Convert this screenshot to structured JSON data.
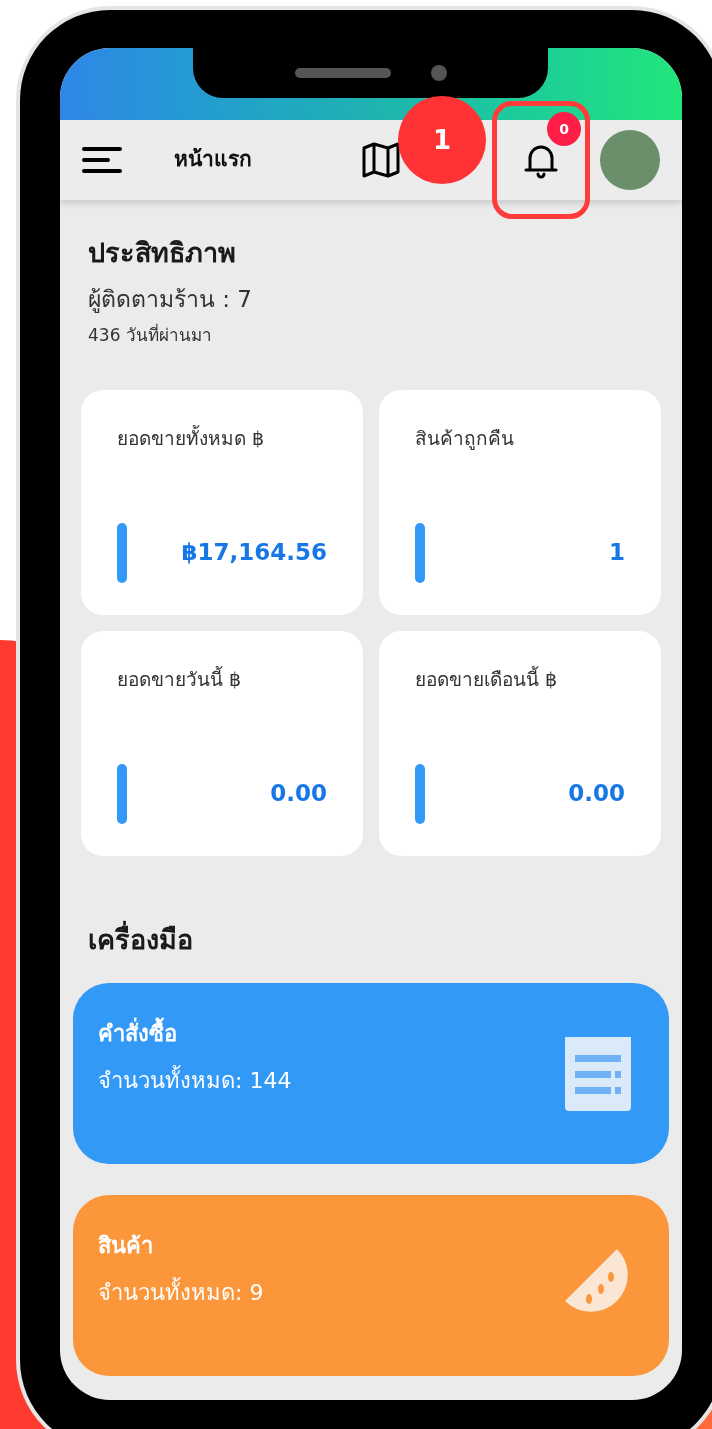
{
  "header": {
    "title": "หน้าแรก",
    "annotation": "1",
    "notification_count": "0"
  },
  "performance": {
    "title": "ประสิทธิภาพ",
    "followers": "ผู้ติดตามร้าน : 7",
    "days": "436 วันที่ผ่านมา"
  },
  "stats": [
    {
      "label": "ยอดขายทั้งหมด ฿",
      "value": "฿17,164.56"
    },
    {
      "label": "สินค้าถูกคืน",
      "value": "1"
    },
    {
      "label": "ยอดขายวันนี้ ฿",
      "value": "0.00"
    },
    {
      "label": "ยอดขายเดือนนี้ ฿",
      "value": "0.00"
    }
  ],
  "tools": {
    "title": "เครื่องมือ",
    "items": [
      {
        "kind": "receipt",
        "color": "#3399f7",
        "title": "คำสั่งซื้อ",
        "count": "จำนวนทั้งหมด: 144"
      },
      {
        "kind": "fruit",
        "color": "#fb963a",
        "title": "สินค้า",
        "count": "จำนวนทั้งหมด: 9"
      }
    ]
  }
}
